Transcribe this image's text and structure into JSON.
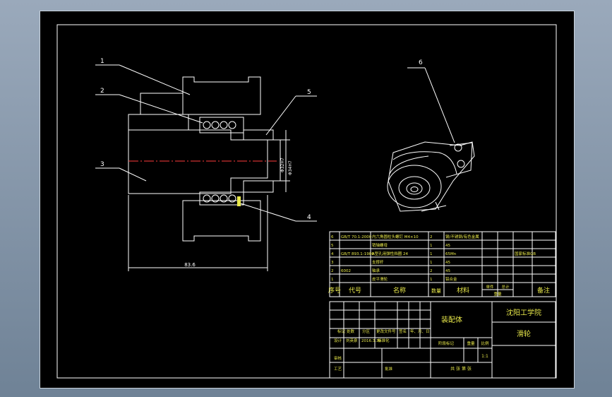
{
  "balloons": {
    "b1": "1",
    "b2": "2",
    "b3": "3",
    "b4": "4",
    "b5": "5",
    "b6": "6"
  },
  "dimensions": {
    "overall_length": "83.6",
    "dia_1": "Φ32H7",
    "dia_2": "Φ34H7"
  },
  "bom": {
    "rows": [
      {
        "no": "6",
        "code": "GB/T 70.1-2000",
        "name": "内六角圆柱头螺钉 M4×10",
        "qty": "2",
        "material": "钢/不锈钢/有色金属",
        "weight": "",
        "note": ""
      },
      {
        "no": "5",
        "code": "",
        "name": "销轴螺母",
        "qty": "1",
        "material": "45",
        "weight": "",
        "note": ""
      },
      {
        "no": "4",
        "code": "GB/T 893.1-1986",
        "name": "A型孔用弹性挡圈 24",
        "qty": "1",
        "material": "65Mn",
        "weight": "",
        "note": "国家标准GB"
      },
      {
        "no": "3",
        "code": "",
        "name": "支撑杆",
        "qty": "1",
        "material": "45",
        "weight": "",
        "note": ""
      },
      {
        "no": "2",
        "code": "6002",
        "name": "轴承",
        "qty": "2",
        "material": "45",
        "weight": "",
        "note": ""
      },
      {
        "no": "1",
        "code": "",
        "name": "皮平滑轮",
        "qty": "1",
        "material": "铝合金",
        "weight": "",
        "note": ""
      }
    ],
    "header": {
      "no": "序号",
      "code": "代号",
      "name": "名称",
      "qty": "数量",
      "material": "材料",
      "unit_weight": "单件",
      "total_weight": "总计",
      "weight": "重量",
      "note": "备注"
    }
  },
  "title_block": {
    "drawing_name": "装配体",
    "school": "沈阳工学院",
    "part_name": "滑轮",
    "row_labels": [
      "标记",
      "处数",
      "分区",
      "更改文件号",
      "签名",
      "年、月、日"
    ],
    "design_label": "设计",
    "designer": "刘英泉",
    "date": "2016.3.30",
    "standardize": "标准化",
    "stage_label": "阶段标记",
    "weight_label": "重量",
    "scale_label": "比例",
    "scale": "1:1",
    "check_label": "审核",
    "process_label": "工艺",
    "approve_label": "批准",
    "sheets": "共  张  第  张"
  }
}
